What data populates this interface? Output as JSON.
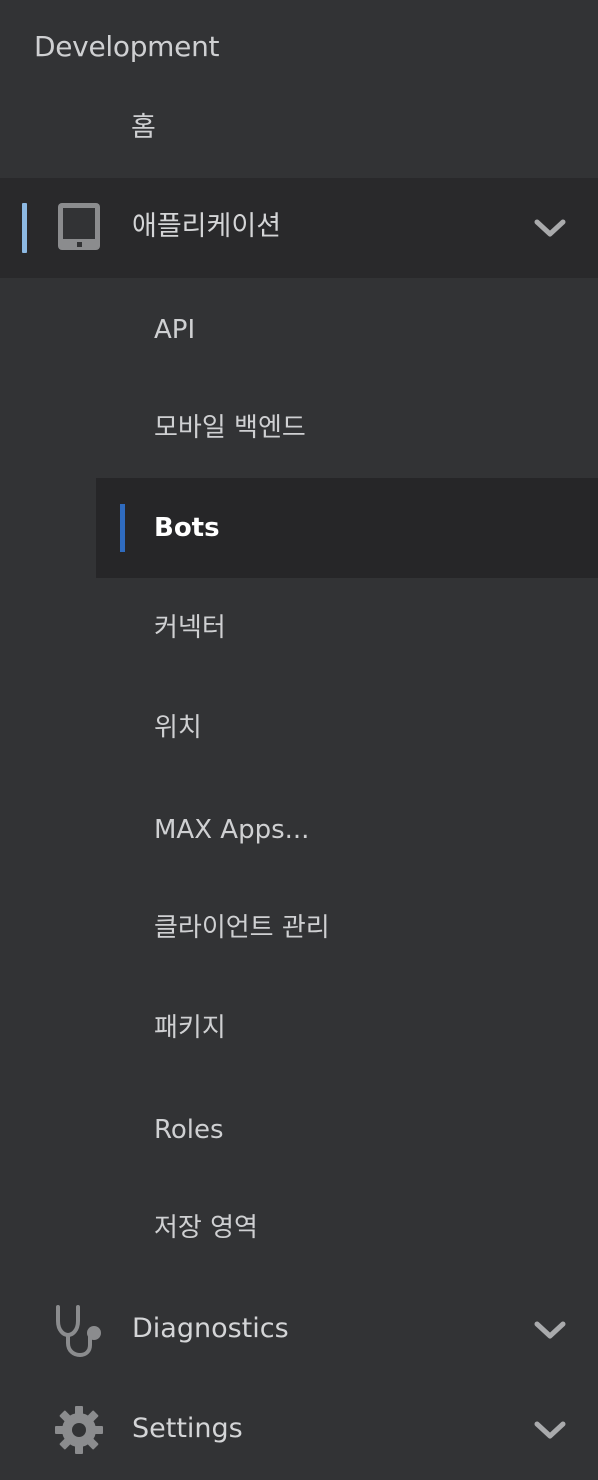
{
  "sidebar": {
    "section_title": "Development",
    "home_label": "홈",
    "applications": {
      "label": "애플리케이션",
      "icon": "tablet-icon",
      "expanded": true,
      "accent_color": "#8db9e3",
      "items": [
        {
          "label": "API"
        },
        {
          "label": "모바일 백엔드"
        },
        {
          "label": "Bots",
          "active": true
        },
        {
          "label": "커넥터"
        },
        {
          "label": "위치"
        },
        {
          "label": "MAX Apps..."
        },
        {
          "label": "클라이언트 관리"
        },
        {
          "label": "패키지"
        },
        {
          "label": "Roles"
        },
        {
          "label": "저장 영역"
        }
      ]
    },
    "diagnostics": {
      "label": "Diagnostics",
      "icon": "stethoscope-icon"
    },
    "settings": {
      "label": "Settings",
      "icon": "gear-icon"
    },
    "active_color": "#2f6bbf"
  }
}
